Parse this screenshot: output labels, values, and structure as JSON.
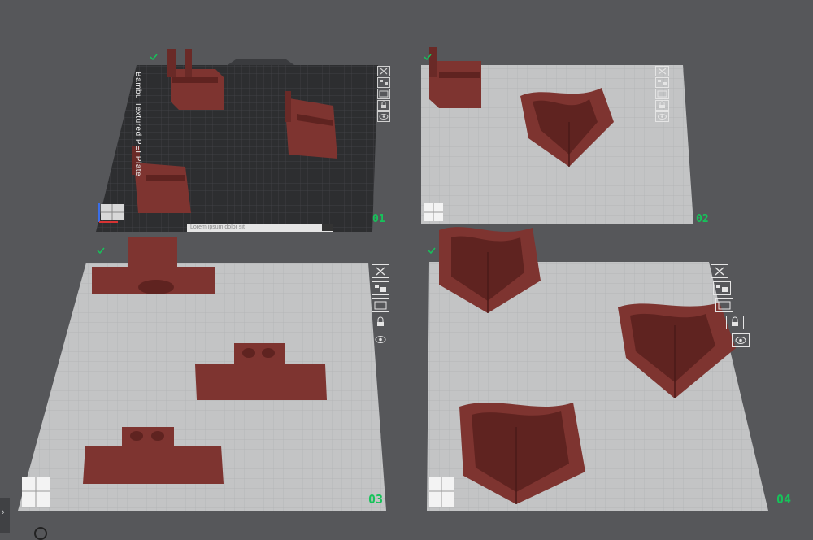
{
  "plates": [
    {
      "id": "plate-1",
      "number": "01",
      "label": "Bambu Textured PEI Plate",
      "caption": "Lorem ipsum dolor sit"
    },
    {
      "id": "plate-2",
      "number": "02"
    },
    {
      "id": "plate-3",
      "number": "03"
    },
    {
      "id": "plate-4",
      "number": "04"
    }
  ],
  "plate_buttons": [
    {
      "name": "close-plate-button",
      "icon": "close-icon"
    },
    {
      "name": "auto-arrange-button",
      "icon": "arrange-icon"
    },
    {
      "name": "plate-settings-button",
      "icon": "settings-icon"
    },
    {
      "name": "lock-plate-button",
      "icon": "lock-icon"
    },
    {
      "name": "view-plate-button",
      "icon": "eye-icon"
    }
  ],
  "colors": {
    "background": "#56575a",
    "plate_light": "#c3c4c5",
    "plate_dark": "#2d2e30",
    "model": "#7e3430",
    "model_dark": "#5f2320",
    "accent": "#16c35a"
  },
  "left_tab": {
    "label": "›"
  }
}
